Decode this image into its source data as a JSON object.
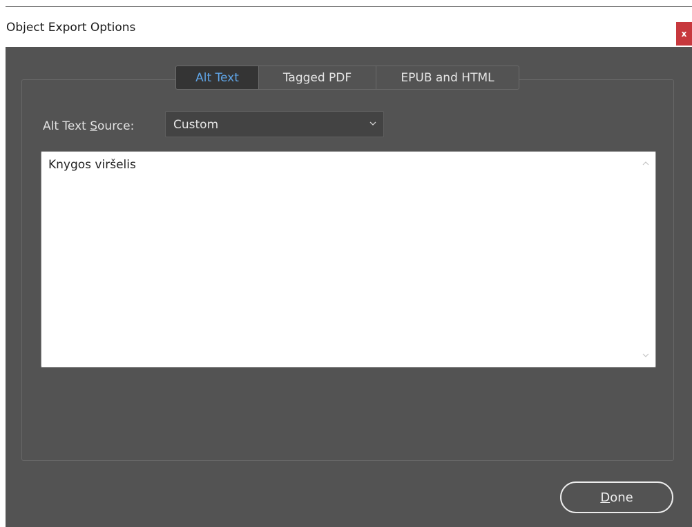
{
  "window": {
    "title": "Object Export Options",
    "close_label": "x"
  },
  "tabs": [
    {
      "label": "Alt Text",
      "active": true
    },
    {
      "label": "Tagged PDF",
      "active": false
    },
    {
      "label": "EPUB and HTML",
      "active": false
    }
  ],
  "alt_text": {
    "source_label_before": "Alt Text ",
    "source_label_underlined": "S",
    "source_label_after": "ource:",
    "source_selected": "Custom",
    "text_value": "Knygos viršelis"
  },
  "footer": {
    "done_underlined": "D",
    "done_rest": "one"
  },
  "colors": {
    "dialog_background": "#535353",
    "active_tab_background": "#343434",
    "active_tab_text": "#5fa4e6",
    "close_button": "#c7383d"
  },
  "icons": {
    "close": "close-icon",
    "dropdown": "chevron-down-icon",
    "scroll_up": "scroll-up-arrow-icon",
    "scroll_down": "scroll-down-arrow-icon"
  }
}
